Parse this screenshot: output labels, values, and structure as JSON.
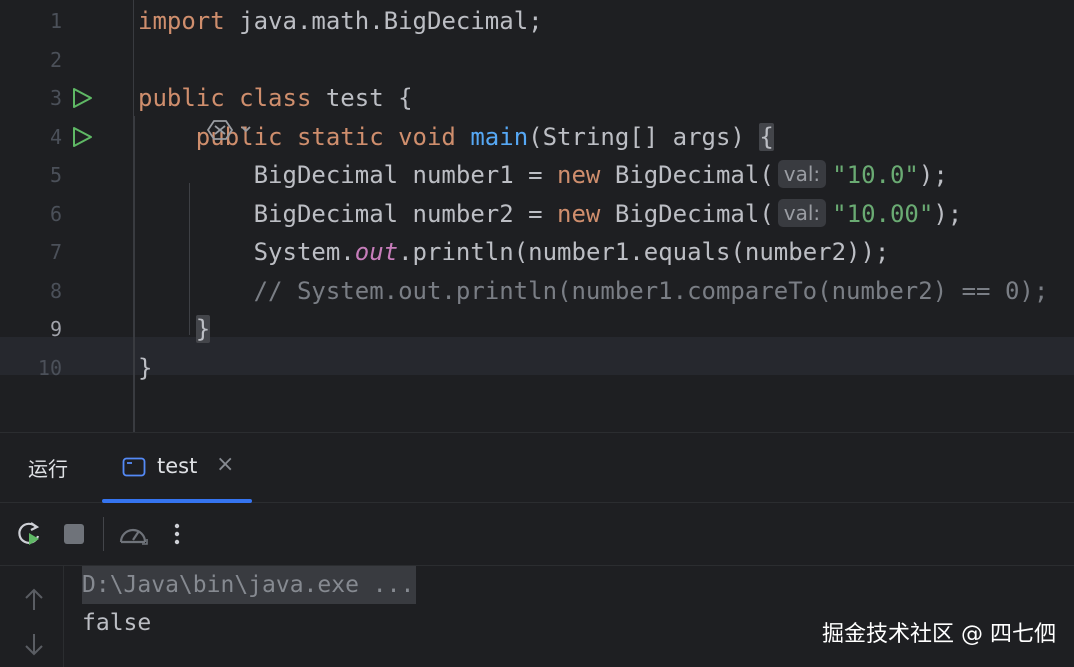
{
  "editor": {
    "lines": [
      {
        "num": "1",
        "tokens": [
          [
            "kw",
            "import "
          ],
          [
            "",
            "java.math.BigDecimal;"
          ]
        ]
      },
      {
        "num": "2",
        "tokens": []
      },
      {
        "num": "3",
        "run": true,
        "tokens": [
          [
            "kw",
            "public class "
          ],
          [
            "",
            "test {"
          ]
        ]
      },
      {
        "num": "4",
        "run": true,
        "tokens": [
          [
            "",
            "    "
          ],
          [
            "kw",
            "public static void "
          ],
          [
            "fn",
            "main"
          ],
          [
            "",
            "(String[] args) "
          ],
          [
            "hl",
            "{"
          ]
        ]
      },
      {
        "num": "5",
        "tokens": [
          [
            "",
            "        BigDecimal number1 = "
          ],
          [
            "kw",
            "new "
          ],
          [
            "",
            "BigDecimal("
          ],
          [
            "hint",
            "val:"
          ],
          [
            "str",
            "\"10.0\""
          ],
          [
            "",
            ");"
          ]
        ]
      },
      {
        "num": "6",
        "tokens": [
          [
            "",
            "        BigDecimal number2 = "
          ],
          [
            "kw",
            "new "
          ],
          [
            "",
            "BigDecimal("
          ],
          [
            "hint",
            "val:"
          ],
          [
            "str",
            "\"10.00\""
          ],
          [
            "",
            ");"
          ]
        ]
      },
      {
        "num": "7",
        "tokens": [
          [
            "",
            "        System."
          ],
          [
            "fld",
            "out"
          ],
          [
            "",
            ".println(number1.equals(number2));"
          ]
        ]
      },
      {
        "num": "8",
        "tokens": [
          [
            "cmt",
            "        // System.out.println(number1.compareTo(number2) == 0);"
          ]
        ]
      },
      {
        "num": "9",
        "active": true,
        "tokens": [
          [
            "",
            "    "
          ],
          [
            "hl",
            "}"
          ]
        ]
      },
      {
        "num": "10",
        "tokens": [
          [
            "",
            "}"
          ]
        ]
      }
    ]
  },
  "run_panel": {
    "title": "运行",
    "tab_label": "test",
    "tab_close": "×",
    "console": {
      "command": "D:\\Java\\bin\\java.exe ...",
      "output": "false"
    }
  },
  "icons": {
    "run_gutter": "run-triangle-icon",
    "rerun": "rerun-icon",
    "stop": "stop-icon",
    "profiler": "profiler-gauge-icon",
    "more": "more-vertical-icon",
    "scroll_up": "arrow-up-icon",
    "scroll_down": "arrow-down-icon"
  },
  "watermark": "掘金技术社区 @ 四七伵",
  "colors": {
    "background": "#1e1f22",
    "keyword": "#cf8e6d",
    "method": "#56a8f5",
    "string": "#6aab73",
    "field": "#c77dbb",
    "comment": "#7a7e85",
    "accent": "#3574f0",
    "run_green": "#5fb865"
  }
}
